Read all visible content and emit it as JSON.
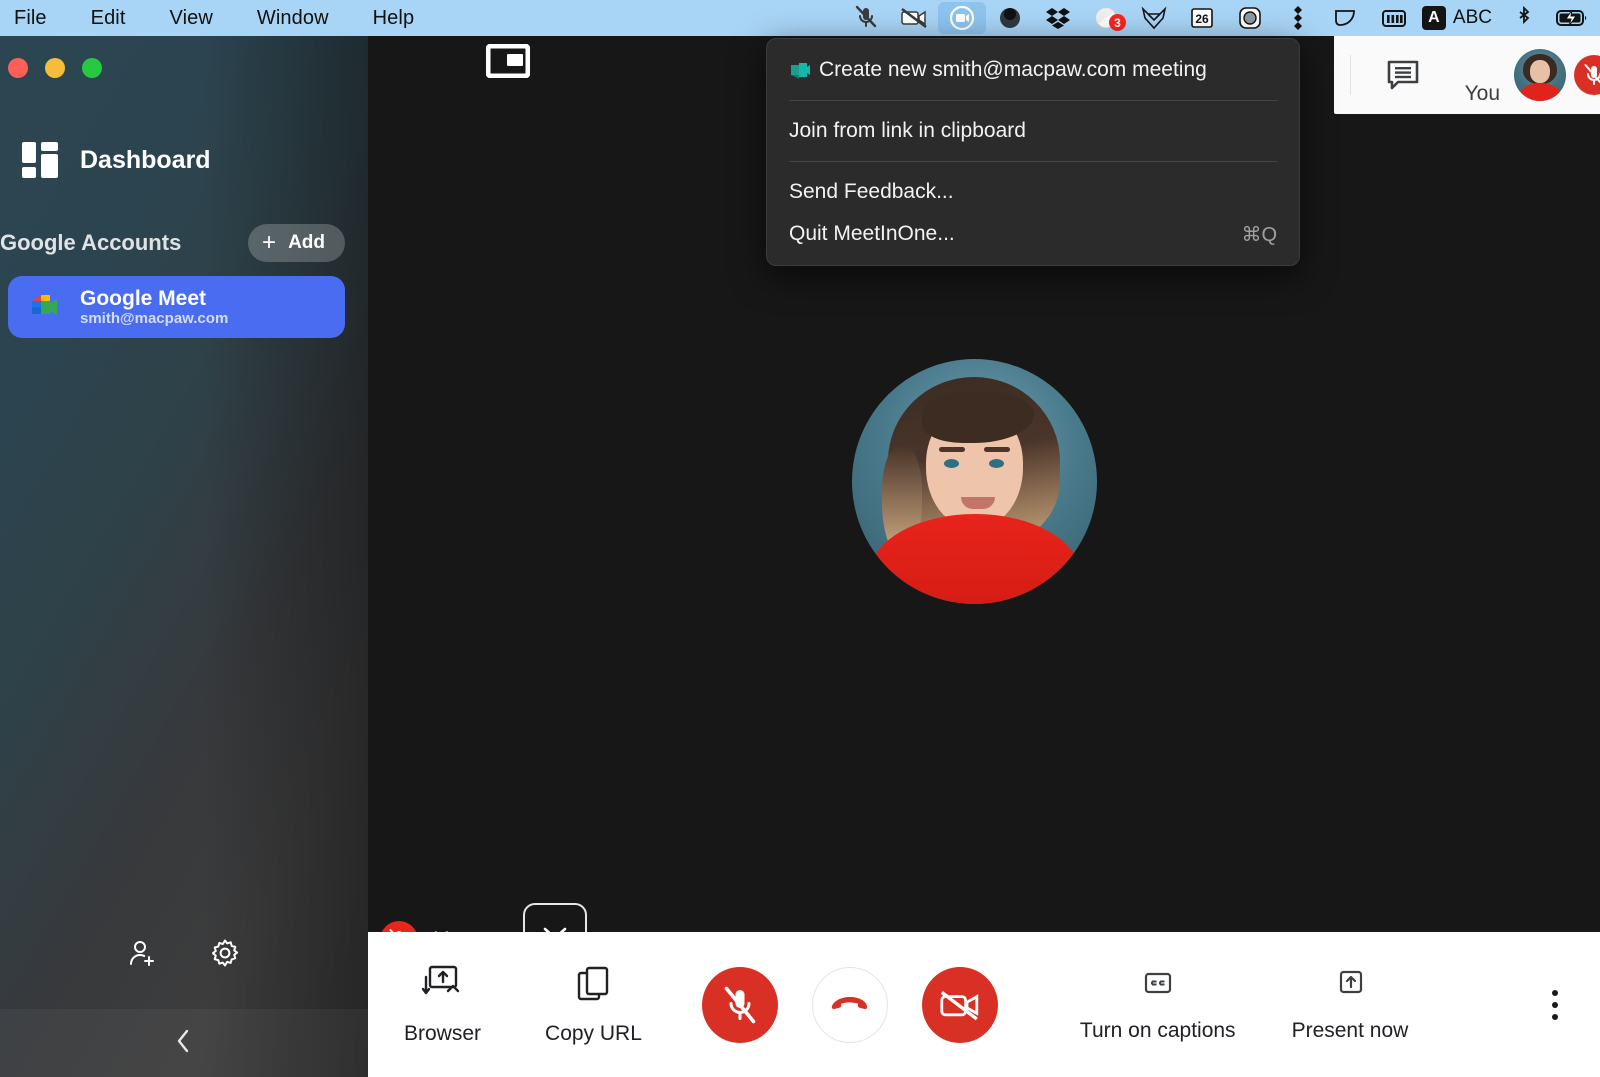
{
  "menubar": {
    "app_menus": [
      {
        "label": "File"
      },
      {
        "label": "Edit"
      },
      {
        "label": "View"
      },
      {
        "label": "Window"
      },
      {
        "label": "Help"
      }
    ],
    "status_icons": [
      {
        "name": "microphone-muted-icon"
      },
      {
        "name": "camera-off-icon"
      },
      {
        "name": "meetinone-icon",
        "active": true
      },
      {
        "name": "bartender-icon"
      },
      {
        "name": "dropbox-icon"
      },
      {
        "name": "notification-icon",
        "badge": "3"
      },
      {
        "name": "fox-icon"
      },
      {
        "name": "calendar-26-icon",
        "label": "26"
      },
      {
        "name": "timemachine-icon"
      },
      {
        "name": "cleanmymac-icon"
      },
      {
        "name": "battery-meter-icon"
      }
    ],
    "input_source": "ABC",
    "input_source_glyph": "A",
    "bluetooth_icon": "bluetooth-icon",
    "battery_icon": "battery-charging-icon",
    "accent_blue": "#a8d4f5"
  },
  "dropdown": {
    "items": [
      {
        "label": "Create new smith@macpaw.com meeting",
        "icon": "google-meet-icon",
        "shortcut": ""
      },
      {
        "label": "Join from link in clipboard",
        "icon": "",
        "shortcut": ""
      },
      {
        "label": "Send Feedback...",
        "icon": "",
        "shortcut": ""
      },
      {
        "label": "Quit MeetInOne...",
        "icon": "",
        "shortcut": "⌘Q"
      }
    ],
    "background": "#2b2b2b"
  },
  "sidebar": {
    "window_controls": [
      "close",
      "minimize",
      "zoom"
    ],
    "title": "Dashboard",
    "logo_icon": "dashboard-grid-icon",
    "section_label": "Google Accounts",
    "add_button": {
      "label": "Add",
      "icon": "plus-icon"
    },
    "accounts": [
      {
        "name": "Google Meet",
        "email": "smith@macpaw.com",
        "icon": "google-meet-icon",
        "selected": true,
        "accent": "#4a6cf0"
      }
    ],
    "footer_icons": [
      {
        "name": "add-person-icon"
      },
      {
        "name": "gear-icon"
      }
    ],
    "collapse_icon": "chevron-left-icon"
  },
  "meet": {
    "pip_icon": "picture-in-picture-icon",
    "topbar": {
      "chat_icon": "chat-bubble-icon",
      "participant_label": "You",
      "avatar_icon": "user-avatar",
      "mute_badge_icon": "microphone-muted-icon"
    },
    "stage": {
      "avatar_icon": "user-avatar-large",
      "nameplate_label": "You",
      "nameplate_mute_icon": "microphone-muted-icon",
      "expand_icon": "chevron-down-icon"
    },
    "controls": [
      {
        "label": "Browser",
        "icon": "open-in-browser-icon",
        "type": "labeled"
      },
      {
        "label": "Copy URL",
        "icon": "copy-icon",
        "type": "labeled"
      },
      {
        "label": "",
        "icon": "microphone-muted-icon",
        "type": "round-red"
      },
      {
        "label": "",
        "icon": "hang-up-icon",
        "type": "round-hangup"
      },
      {
        "label": "",
        "icon": "camera-off-icon",
        "type": "round-red"
      },
      {
        "label": "Turn on captions",
        "icon": "closed-captions-icon",
        "type": "labeled"
      },
      {
        "label": "Present now",
        "icon": "present-screen-icon",
        "type": "labeled"
      },
      {
        "label": "",
        "icon": "more-options-icon",
        "type": "kebab"
      }
    ],
    "colors": {
      "danger": "#d93025",
      "bar_background": "#ffffff",
      "stage_background": "#171717"
    }
  }
}
